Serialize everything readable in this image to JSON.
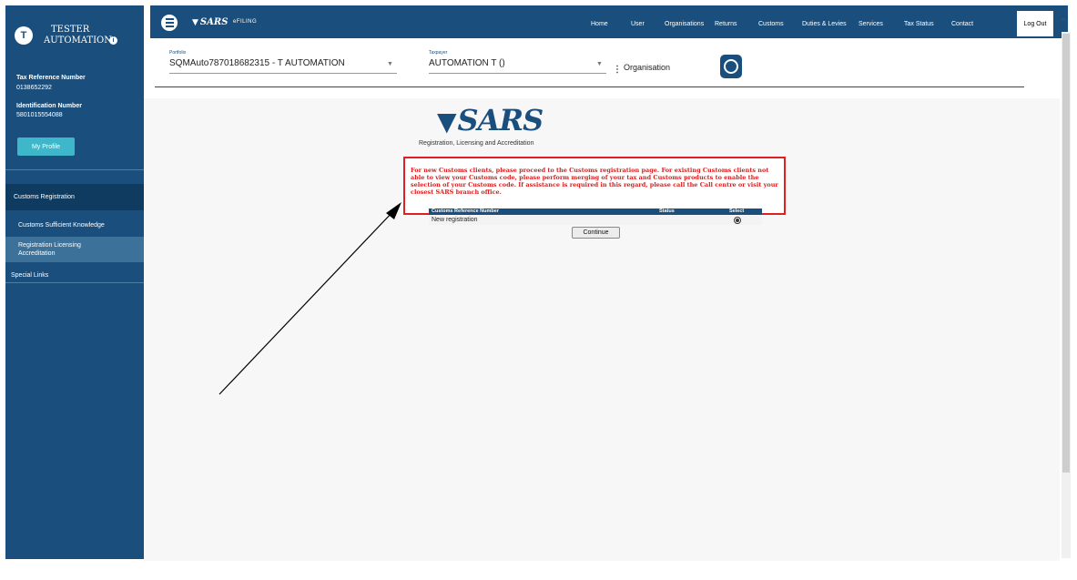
{
  "sidebar": {
    "avatar_initial": "T",
    "user_first": "TESTER",
    "user_last": "AUTOMATION",
    "tax_ref_label": "Tax Reference Number",
    "tax_ref_value": "0138652292",
    "id_label": "Identification Number",
    "id_value": "5801015554088",
    "profile_button": "My Profile",
    "menu": [
      {
        "label": "Customs Registration"
      },
      {
        "label": "Customs Sufficient Knowledge"
      },
      {
        "label": "Registration Licensing Accreditation"
      },
      {
        "label": "Special Links"
      }
    ]
  },
  "header": {
    "logo": "SARS",
    "efiling": "eFILING",
    "nav": [
      "Home",
      "User",
      "Organisations",
      "Returns",
      "Customs",
      "Duties & Levies",
      "Services",
      "Tax Status",
      "Contact"
    ],
    "logout": "Log Out"
  },
  "selectors": {
    "portfolio_label": "Portfolio",
    "portfolio_value": "SQMAuto787018682315 - T AUTOMATION",
    "taxpayer_label": "Taxpayer",
    "taxpayer_value": "AUTOMATION T ()",
    "organisation_label": "Organisation"
  },
  "main": {
    "logo": "SARS",
    "title": "Registration, Licensing and Accreditation",
    "notice": "For new Customs clients, please proceed to the Customs registration page. For existing Customs clients not able to view your Customs code, please perform merging of your tax and Customs products to enable the selection of your Customs code. If assistance is required in this regard, please call the Call centre or visit your closest SARS branch office.",
    "table": {
      "headers": [
        "Customs Reference Number",
        "Status",
        "Select"
      ],
      "rows": [
        {
          "reference": "New registration",
          "status": "",
          "selected": true
        }
      ]
    },
    "continue_button": "Continue"
  },
  "colors": {
    "brand": "#1a4f7d",
    "accent_button": "#3db7c9",
    "notice_red": "#e02020"
  }
}
